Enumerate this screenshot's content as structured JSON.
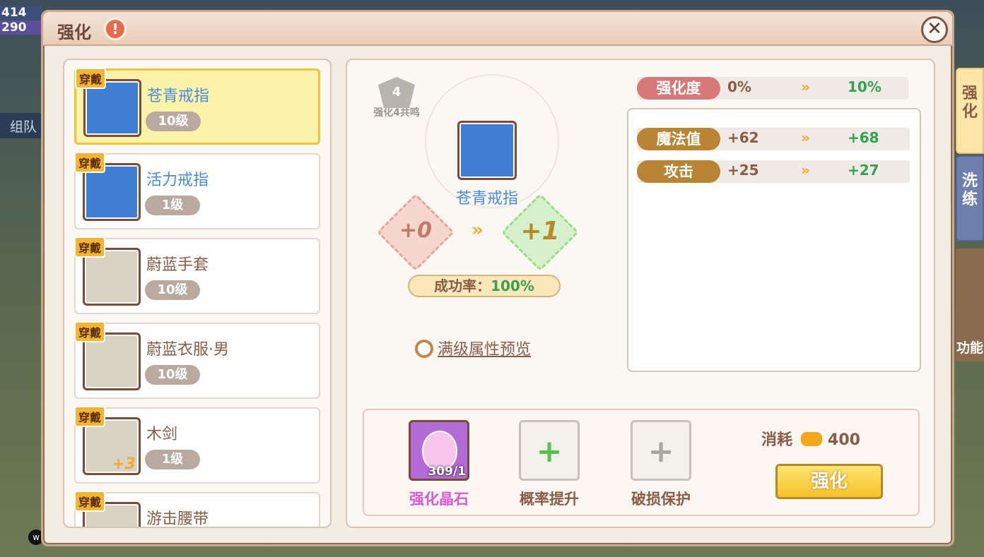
{
  "background": {
    "bars": [
      "414",
      "290"
    ],
    "team_label": "组队",
    "w_badge": "w"
  },
  "panel": {
    "title": "强化",
    "warn_icon": "!",
    "close_icon": "✕"
  },
  "items": [
    {
      "tag": "穿戴",
      "name": "苍青戒指",
      "level": "10级",
      "selected": true
    },
    {
      "tag": "穿戴",
      "name": "活力戒指",
      "level": "1级"
    },
    {
      "tag": "穿戴",
      "name": "蔚蓝手套",
      "level": "10级"
    },
    {
      "tag": "穿戴",
      "name": "蔚蓝衣服·男",
      "level": "10级"
    },
    {
      "tag": "穿戴",
      "name": "木剑",
      "level": "1级",
      "bonus": "+3"
    },
    {
      "tag": "穿戴",
      "name": "游击腰带",
      "level": ""
    }
  ],
  "center": {
    "resonance_number": "4",
    "resonance_label": "强化4共鸣",
    "item_name": "苍青戒指",
    "from_level": "+0",
    "to_level": "+1",
    "arrow": "»",
    "success_label": "成功率：",
    "success_value": "100%",
    "preview_link": "满级属性预览"
  },
  "stats": {
    "enhance": {
      "label": "强化度",
      "from": "0%",
      "to": "10%"
    },
    "rows": [
      {
        "label": "魔法值",
        "from": "+62",
        "to": "+68"
      },
      {
        "label": "攻击",
        "from": "+25",
        "to": "+27"
      }
    ],
    "arrow": "»"
  },
  "materials": {
    "crystal": {
      "name": "强化晶石",
      "count": "309/1"
    },
    "rate_up": {
      "name": "概率提升",
      "plus": "+"
    },
    "protect": {
      "name": "破损保护",
      "plus": "+"
    },
    "cost_label": "消耗",
    "cost_value": "400",
    "button": "强化"
  },
  "side_tabs": {
    "enhance": "强\n化",
    "refine": "洗\n练",
    "extra": "功能"
  },
  "colors": {
    "accent_gold": "#f5c22a",
    "green_value": "#36a055",
    "blue_name": "#4a8be0"
  }
}
